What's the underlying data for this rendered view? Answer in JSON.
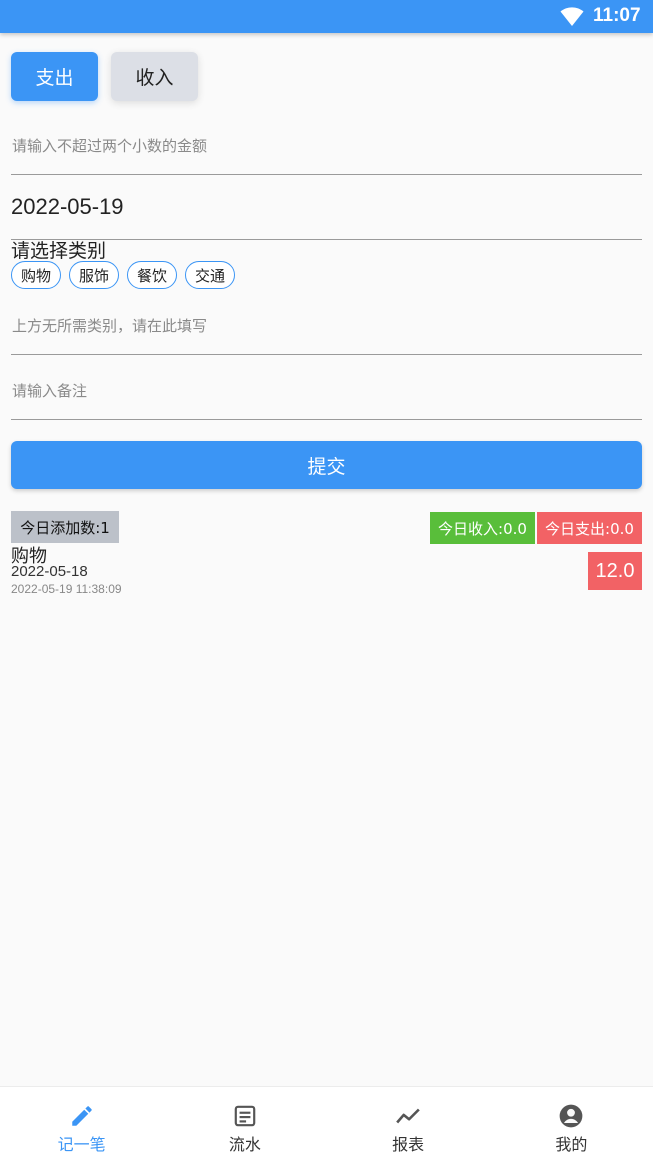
{
  "status_bar": {
    "time": "11:07"
  },
  "type_toggle": {
    "expense_label": "支出",
    "income_label": "收入"
  },
  "form": {
    "amount_placeholder": "请输入不超过两个小数的金额",
    "date_value": "2022-05-19",
    "category_title": "请选择类别",
    "categories": [
      "购物",
      "服饰",
      "餐饮",
      "交通"
    ],
    "custom_category_placeholder": "上方无所需类别，请在此填写",
    "note_placeholder": "请输入备注",
    "submit_label": "提交"
  },
  "summary": {
    "added_today": "今日添加数:1",
    "income_today": "今日收入:0.0",
    "expense_today": "今日支出:0.0"
  },
  "records": [
    {
      "category": "购物",
      "date": "2022-05-18",
      "created": "2022-05-19 11:38:09",
      "amount": "12.0"
    }
  ],
  "tabs": [
    {
      "label": "记一笔",
      "icon": "pencil-icon",
      "active": true
    },
    {
      "label": "流水",
      "icon": "list-icon",
      "active": false
    },
    {
      "label": "报表",
      "icon": "chart-icon",
      "active": false
    },
    {
      "label": "我的",
      "icon": "account-icon",
      "active": false
    }
  ],
  "colors": {
    "accent": "#3b95f5",
    "income": "#59be3a",
    "expense": "#f26265"
  }
}
